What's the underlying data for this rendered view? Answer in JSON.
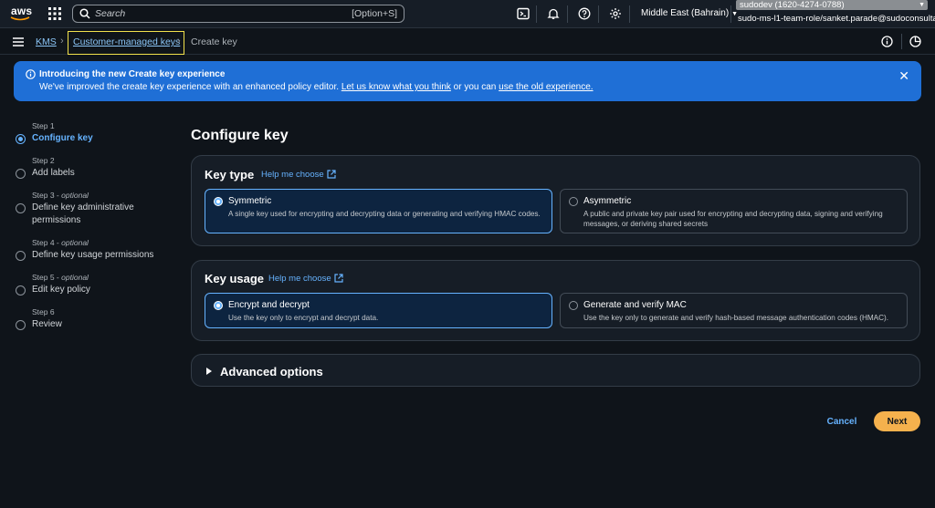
{
  "topnav": {
    "logo_text": "aws",
    "search_placeholder": "Search",
    "search_shortcut": "[Option+S]",
    "icons": [
      "cloudshell-icon",
      "bell-icon",
      "help-icon",
      "gear-icon"
    ],
    "region": "Middle East (Bahrain)",
    "account": "sudodev (1620-4274-0788)",
    "role": "sudo-ms-l1-team-role/sanket.parade@sudoconsulta..."
  },
  "breadcrumb": {
    "items": [
      "KMS",
      "Customer-managed keys",
      "Create key"
    ]
  },
  "flash": {
    "title": "Introducing the new Create key experience",
    "msg_prefix": "We've improved the create key experience with an enhanced policy editor.",
    "link1": "Let us know what you think",
    "msg_mid": "or you can",
    "link2": "use the old experience."
  },
  "steps": [
    {
      "label": "Step 1",
      "optional": "",
      "name": "Configure key",
      "active": true
    },
    {
      "label": "Step 2",
      "optional": "",
      "name": "Add labels",
      "active": false
    },
    {
      "label": "Step 3 -",
      "optional": "optional",
      "name": "Define key administrative permissions",
      "active": false
    },
    {
      "label": "Step 4 -",
      "optional": "optional",
      "name": "Define key usage permissions",
      "active": false
    },
    {
      "label": "Step 5 -",
      "optional": "optional",
      "name": "Edit key policy",
      "active": false
    },
    {
      "label": "Step 6",
      "optional": "",
      "name": "Review",
      "active": false
    }
  ],
  "main": {
    "title": "Configure key",
    "key_type": {
      "heading": "Key type",
      "help": "Help me choose",
      "options": [
        {
          "title": "Symmetric",
          "desc": "A single key used for encrypting and decrypting data or generating and verifying HMAC codes.",
          "selected": true
        },
        {
          "title": "Asymmetric",
          "desc": "A public and private key pair used for encrypting and decrypting data, signing and verifying messages, or deriving shared secrets",
          "selected": false
        }
      ]
    },
    "key_usage": {
      "heading": "Key usage",
      "help": "Help me choose",
      "options": [
        {
          "title": "Encrypt and decrypt",
          "desc": "Use the key only to encrypt and decrypt data.",
          "selected": true
        },
        {
          "title": "Generate and verify MAC",
          "desc": "Use the key only to generate and verify hash-based message authentication codes (HMAC).",
          "selected": false
        }
      ]
    },
    "advanced": "Advanced options",
    "cancel": "Cancel",
    "next": "Next"
  },
  "colors": {
    "accent": "#66b3ff",
    "banner": "#1f6fd6",
    "primary_button": "#f5b14d",
    "background": "#0f141a"
  }
}
